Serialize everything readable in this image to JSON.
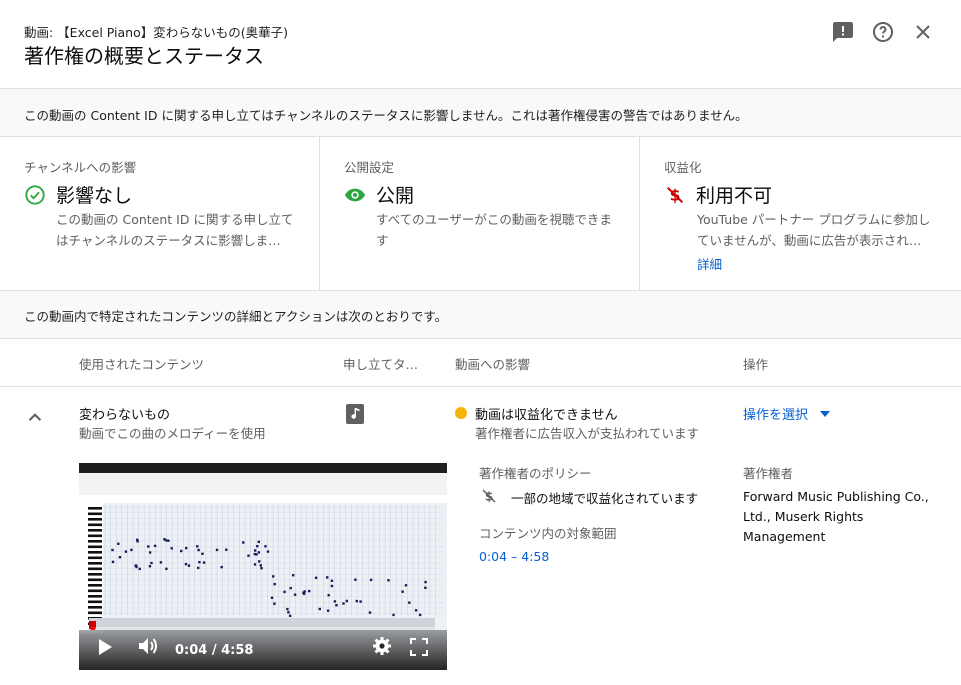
{
  "header": {
    "video_line": "動画: 【Excel Piano】変わらないもの(奥華子)",
    "title": "著作権の概要とステータス"
  },
  "notice": "この動画の Content ID に関する申し立てはチャンネルのステータスに影響しません。これは著作権侵害の警告ではありません。",
  "status": {
    "channel": {
      "label": "チャンネルへの影響",
      "value": "影響なし",
      "desc": "この動画の Content ID に関する申し立てはチャンネルのステータスに影響しま…",
      "icon": "check-circle-icon",
      "color": "#2ba640"
    },
    "visibility": {
      "label": "公開設定",
      "value": "公開",
      "desc": "すべてのユーザーがこの動画を視聴できます",
      "icon": "eye-icon",
      "color": "#2ba640"
    },
    "monetization": {
      "label": "収益化",
      "value": "利用不可",
      "desc": "YouTube パートナー プログラムに参加していませんが、動画に広告が表示され…",
      "link": "詳細",
      "icon": "demonetized-icon",
      "color": "#cc0000"
    }
  },
  "section_notice": "この動画内で特定されたコンテンツの詳細とアクションは次のとおりです。",
  "table": {
    "headers": [
      "使用されたコンテンツ",
      "申し立てタ…",
      "動画への影響",
      "操作"
    ],
    "row": {
      "title": "変わらないもの",
      "subtitle": "動画でこの曲のメロディーを使用",
      "type_icon": "music-note-icon",
      "impact_title": "動画は収益化できません",
      "impact_sub": "著作権者に広告収入が支払われています",
      "impact_color": "#f6b40b",
      "action": "操作を選択",
      "policy_label": "著作権者のポリシー",
      "policy_text": "一部の地域で収益化されています",
      "range_label": "コンテンツ内の対象範囲",
      "range_value": "0:04 – 4:58",
      "owner_label": "著作権者",
      "owner_text": "Forward Music Publishing Co., Ltd., Muserk Rights Management",
      "player": {
        "time": "0:04 / 4:58",
        "progress": 0.013
      }
    }
  },
  "colors": {
    "link": "#065fd4",
    "text": "#0d0d0d",
    "secondary": "#5f5f5f"
  }
}
